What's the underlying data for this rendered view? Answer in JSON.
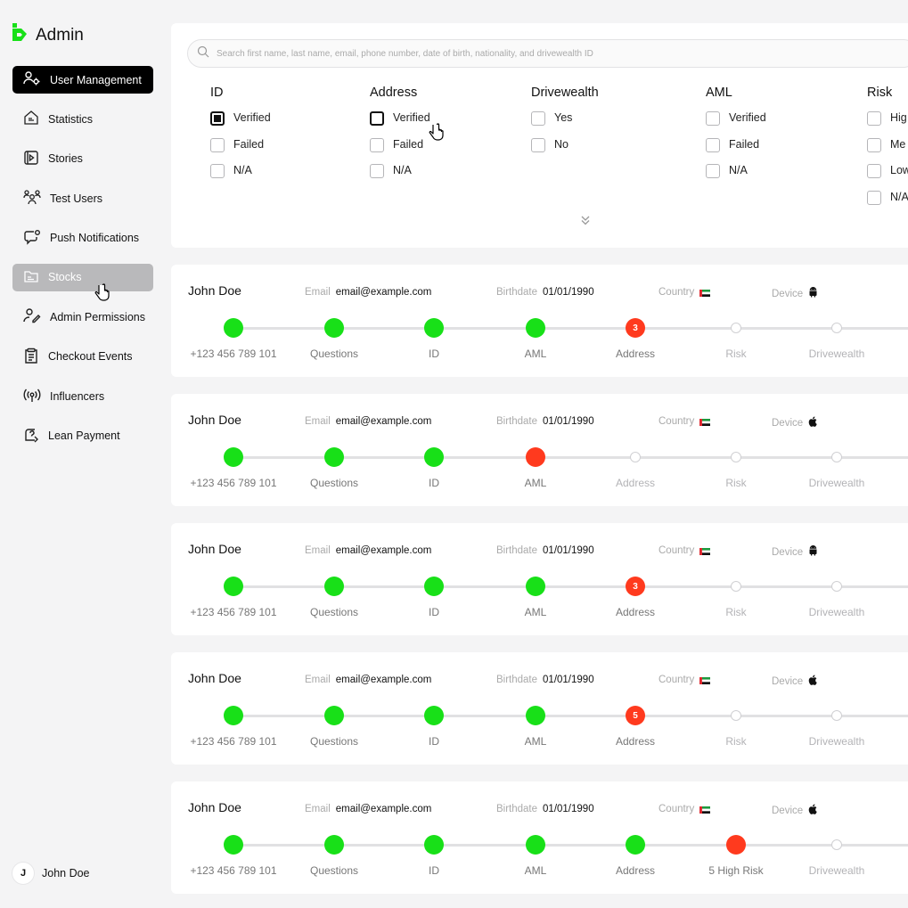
{
  "app": {
    "title": "Admin",
    "brand_color": "#18e018"
  },
  "sidebar": {
    "items": [
      {
        "label": "User Management",
        "icon": "users-gear-icon",
        "state": "active"
      },
      {
        "label": "Statistics",
        "icon": "home-chart-icon",
        "state": ""
      },
      {
        "label": "Stories",
        "icon": "stories-icon",
        "state": ""
      },
      {
        "label": "Test Users",
        "icon": "test-users-icon",
        "state": ""
      },
      {
        "label": "Push Notifications",
        "icon": "chat-bell-icon",
        "state": ""
      },
      {
        "label": "Stocks",
        "icon": "folder-icon",
        "state": "hover"
      },
      {
        "label": "Admin Permissions",
        "icon": "user-pen-icon",
        "state": ""
      },
      {
        "label": "Checkout Events",
        "icon": "clipboard-icon",
        "state": ""
      },
      {
        "label": "Influencers",
        "icon": "broadcast-icon",
        "state": ""
      },
      {
        "label": "Lean Payment",
        "icon": "payment-icon",
        "state": ""
      }
    ],
    "user": {
      "initial": "J",
      "name": "John Doe"
    }
  },
  "search": {
    "placeholder": "Search first name, last name, email, phone number, date of birth, nationality, and drivewealth ID"
  },
  "filters": [
    {
      "title": "ID",
      "options": [
        {
          "label": "Verified",
          "checked": true
        },
        {
          "label": "Failed",
          "checked": false
        },
        {
          "label": "N/A",
          "checked": false
        }
      ]
    },
    {
      "title": "Address",
      "options": [
        {
          "label": "Verified",
          "checked": false
        },
        {
          "label": "Failed",
          "checked": false
        },
        {
          "label": "N/A",
          "checked": false
        }
      ]
    },
    {
      "title": "Drivewealth",
      "options": [
        {
          "label": "Yes",
          "checked": false
        },
        {
          "label": "No",
          "checked": false
        }
      ]
    },
    {
      "title": "AML",
      "options": [
        {
          "label": "Verified",
          "checked": false
        },
        {
          "label": "Failed",
          "checked": false
        },
        {
          "label": "N/A",
          "checked": false
        }
      ]
    },
    {
      "title": "Risk",
      "options": [
        {
          "label": "Hig",
          "checked": false
        },
        {
          "label": "Me",
          "checked": false
        },
        {
          "label": "Low",
          "checked": false
        },
        {
          "label": "N/A",
          "checked": false
        }
      ]
    }
  ],
  "labels": {
    "email": "Email",
    "birthdate": "Birthdate",
    "country": "Country",
    "device": "Device"
  },
  "users": [
    {
      "name": "John Doe",
      "email": "email@example.com",
      "birthdate": "01/01/1990",
      "device": "android-icon",
      "steps": [
        {
          "label": "+123 456 789 101",
          "status": "done",
          "badge": ""
        },
        {
          "label": "Questions",
          "status": "done",
          "badge": ""
        },
        {
          "label": "ID",
          "status": "done",
          "badge": ""
        },
        {
          "label": "AML",
          "status": "done",
          "badge": ""
        },
        {
          "label": "Address",
          "status": "error",
          "badge": "3"
        },
        {
          "label": "Risk",
          "status": "pending",
          "badge": ""
        },
        {
          "label": "Drivewealth",
          "status": "pending",
          "badge": ""
        }
      ]
    },
    {
      "name": "John Doe",
      "email": "email@example.com",
      "birthdate": "01/01/1990",
      "device": "apple-icon",
      "steps": [
        {
          "label": "+123 456 789 101",
          "status": "done",
          "badge": ""
        },
        {
          "label": "Questions",
          "status": "done",
          "badge": ""
        },
        {
          "label": "ID",
          "status": "done",
          "badge": ""
        },
        {
          "label": "AML",
          "status": "error",
          "badge": ""
        },
        {
          "label": "Address",
          "status": "pending",
          "badge": ""
        },
        {
          "label": "Risk",
          "status": "pending",
          "badge": ""
        },
        {
          "label": "Drivewealth",
          "status": "pending",
          "badge": ""
        }
      ]
    },
    {
      "name": "John Doe",
      "email": "email@example.com",
      "birthdate": "01/01/1990",
      "device": "android-icon",
      "steps": [
        {
          "label": "+123 456 789 101",
          "status": "done",
          "badge": ""
        },
        {
          "label": "Questions",
          "status": "done",
          "badge": ""
        },
        {
          "label": "ID",
          "status": "done",
          "badge": ""
        },
        {
          "label": "AML",
          "status": "done",
          "badge": ""
        },
        {
          "label": "Address",
          "status": "error",
          "badge": "3"
        },
        {
          "label": "Risk",
          "status": "pending",
          "badge": ""
        },
        {
          "label": "Drivewealth",
          "status": "pending",
          "badge": ""
        }
      ]
    },
    {
      "name": "John Doe",
      "email": "email@example.com",
      "birthdate": "01/01/1990",
      "device": "apple-icon",
      "steps": [
        {
          "label": "+123 456 789 101",
          "status": "done",
          "badge": ""
        },
        {
          "label": "Questions",
          "status": "done",
          "badge": ""
        },
        {
          "label": "ID",
          "status": "done",
          "badge": ""
        },
        {
          "label": "AML",
          "status": "done",
          "badge": ""
        },
        {
          "label": "Address",
          "status": "error",
          "badge": "5"
        },
        {
          "label": "Risk",
          "status": "pending",
          "badge": ""
        },
        {
          "label": "Drivewealth",
          "status": "pending",
          "badge": ""
        }
      ]
    },
    {
      "name": "John Doe",
      "email": "email@example.com",
      "birthdate": "01/01/1990",
      "device": "apple-icon",
      "steps": [
        {
          "label": "+123 456 789 101",
          "status": "done",
          "badge": ""
        },
        {
          "label": "Questions",
          "status": "done",
          "badge": ""
        },
        {
          "label": "ID",
          "status": "done",
          "badge": ""
        },
        {
          "label": "AML",
          "status": "done",
          "badge": ""
        },
        {
          "label": "Address",
          "status": "done",
          "badge": ""
        },
        {
          "label": "5 High Risk",
          "status": "error",
          "badge": ""
        },
        {
          "label": "Drivewealth",
          "status": "pending",
          "badge": ""
        }
      ]
    }
  ],
  "colors": {
    "done": "#18e018",
    "error": "#ff3a1e",
    "pending": "#d0d0d3",
    "active_nav": "#000000"
  }
}
